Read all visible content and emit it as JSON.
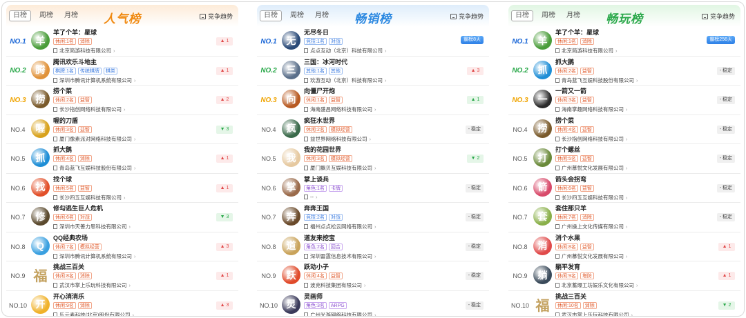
{
  "colors": {
    "pop_header": "#fdebd8",
    "sale_header": "#deedfb",
    "play_header": "#e1f6e3",
    "rank1": "#1a66d6",
    "rank2": "#2aa84a",
    "rank3": "#f0a400"
  },
  "panels": [
    {
      "id": "popular",
      "tabs": [
        "日榜",
        "周榜",
        "月榜"
      ],
      "title": "人气榜",
      "title_color": "#f08a12",
      "trend": "竞争趋势",
      "rows": [
        {
          "rank": "NO.1",
          "name": "羊了个羊：星球",
          "tags": [
            {
              "t": "休闲:1名",
              "c": "orange"
            },
            {
              "t": "消除",
              "c": "orange"
            }
          ],
          "company": "北京简游科技有限公司",
          "badge": "▲ 1",
          "btype": "up",
          "icon": "sheep-icon",
          "bg": "#4a9d3a"
        },
        {
          "rank": "NO.2",
          "name": "腾讯欢乐斗地主",
          "tags": [
            {
              "t": "棋牌:1名",
              "c": "blue"
            },
            {
              "t": "传统棋牌",
              "c": "blue"
            },
            {
              "t": "棋类",
              "c": "blue"
            }
          ],
          "company": "深圳市腾讯计算机系统有限公司",
          "badge": "▲ 1",
          "btype": "up",
          "icon": "farmer-icon",
          "bg": "#e0923a"
        },
        {
          "rank": "NO.3",
          "name": "捞个菜",
          "tags": [
            {
              "t": "休闲:2名",
              "c": "orange"
            },
            {
              "t": "益智",
              "c": "orange"
            }
          ],
          "company": "长沙指创网络科技有限公司",
          "badge": "▲ 2",
          "btype": "up",
          "icon": "vegetable-icon",
          "bg": "#7a5a2b"
        },
        {
          "rank": "NO.4",
          "name": "喔的刀盾",
          "tags": [
            {
              "t": "休闲:3名",
              "c": "orange"
            },
            {
              "t": "益智",
              "c": "orange"
            }
          ],
          "company": "厦门像素派对网络科技有限公司",
          "badge": "▼ 3",
          "btype": "down",
          "icon": "knife-icon",
          "bg": "#d8a21c"
        },
        {
          "rank": "NO.5",
          "name": "抓大鹅",
          "tags": [
            {
              "t": "休闲:4名",
              "c": "orange"
            },
            {
              "t": "消除",
              "c": "orange"
            }
          ],
          "company": "青岛蓝飞互娱科技股份有限公司",
          "badge": "▲ 1",
          "btype": "up",
          "icon": "goose-icon",
          "bg": "#1e8ed6"
        },
        {
          "rank": "NO.6",
          "name": "找个球",
          "tags": [
            {
              "t": "休闲:5名",
              "c": "orange"
            },
            {
              "t": "益智",
              "c": "orange"
            }
          ],
          "company": "长沙四五互娱科技有限公司",
          "badge": "▲ 1",
          "btype": "up",
          "icon": "ball-icon",
          "bg": "#e2502a"
        },
        {
          "rank": "NO.7",
          "name": "修勾逃生巨人危机",
          "tags": [
            {
              "t": "休闲:6名",
              "c": "orange"
            },
            {
              "t": "对战",
              "c": "orange"
            }
          ],
          "company": "深圳市天善力思科技有限公司",
          "badge": "▼ 3",
          "btype": "down",
          "icon": "dog-icon",
          "bg": "#5b4a2e"
        },
        {
          "rank": "NO.8",
          "name": "QQ经典农场",
          "tags": [
            {
              "t": "休闲:7名",
              "c": "orange"
            },
            {
              "t": "模拟经营",
              "c": "orange"
            }
          ],
          "company": "深圳市腾讯计算机系统有限公司",
          "badge": "▲ 3",
          "btype": "up",
          "icon": "farm-icon",
          "bg": "#3aa0e0"
        },
        {
          "rank": "NO.9",
          "name": "挑战三百关",
          "tags": [
            {
              "t": "休闲:8名",
              "c": "orange"
            },
            {
              "t": "消除",
              "c": "orange"
            }
          ],
          "company": "武汉市掌上乐玩科技有限公司",
          "badge": "▲ 1",
          "btype": "up",
          "icon": "fu-icon",
          "bg": "fu"
        },
        {
          "rank": "NO.10",
          "name": "开心消消乐",
          "tags": [
            {
              "t": "休闲:9名",
              "c": "orange"
            },
            {
              "t": "消除",
              "c": "orange"
            }
          ],
          "company": "乐元素科技(北京)股份有限公司",
          "badge": "▲ 3",
          "btype": "up",
          "icon": "chick-icon",
          "bg": "#f0b22a"
        }
      ]
    },
    {
      "id": "bestseller",
      "tabs": [
        "日榜",
        "周榜",
        "月榜"
      ],
      "title": "畅销榜",
      "title_color": "#2a87e0",
      "trend": "竞争趋势",
      "rows": [
        {
          "rank": "NO.1",
          "name": "无尽冬日",
          "tags": [
            {
              "t": "竞技:1名",
              "c": "blue"
            },
            {
              "t": "对战",
              "c": "blue"
            }
          ],
          "company": "点点互动（北京）科技有限公司",
          "badge": "霸榜8天",
          "btype": "pill",
          "icon": "winter-icon",
          "bg": "#2a4a78"
        },
        {
          "rank": "NO.2",
          "name": "三国：冰河时代",
          "tags": [
            {
              "t": "其他:1名",
              "c": "blue"
            },
            {
              "t": "其他",
              "c": "blue"
            }
          ],
          "company": "欢游互动（北京）科技有限公司",
          "badge": "▲ 3",
          "btype": "up",
          "icon": "warrior-icon",
          "bg": "#5a6f8a"
        },
        {
          "rank": "NO.3",
          "name": "向僵尸开炮",
          "tags": [
            {
              "t": "休闲:1名",
              "c": "orange"
            },
            {
              "t": "益智",
              "c": "orange"
            }
          ],
          "company": "海南盛昌网络科技有限公司",
          "badge": "▲ 1",
          "btype": "down",
          "icon": "zombie-icon",
          "bg": "#b85a22"
        },
        {
          "rank": "NO.4",
          "name": "疯狂水世界",
          "tags": [
            {
              "t": "休闲:2名",
              "c": "orange"
            },
            {
              "t": "模拟经营",
              "c": "orange"
            }
          ],
          "company": "益世界网络科技有限公司",
          "badge": "- 稳定",
          "btype": "flat",
          "icon": "water-icon",
          "bg": "#3a6a4a"
        },
        {
          "rank": "NO.5",
          "name": "我的花园世界",
          "tags": [
            {
              "t": "休闲:3名",
              "c": "orange"
            },
            {
              "t": "模拟经营",
              "c": "orange"
            }
          ],
          "company": "厦门飘贝互娱科技有限公司",
          "badge": "▼ 2",
          "btype": "down",
          "icon": "garden-icon",
          "bg": "#e6c9a0"
        },
        {
          "rank": "NO.6",
          "name": "掌上谈兵",
          "tags": [
            {
              "t": "角色:1名",
              "c": "purple"
            },
            {
              "t": "卡牌",
              "c": "purple"
            }
          ],
          "company": "--",
          "badge": "- 稳定",
          "btype": "flat",
          "icon": "soldier-icon",
          "bg": "#9a6a4a"
        },
        {
          "rank": "NO.7",
          "name": "奔奔王国",
          "tags": [
            {
              "t": "竞技:2名",
              "c": "blue"
            },
            {
              "t": "对战",
              "c": "blue"
            }
          ],
          "company": "福州点点松云网络有限公司",
          "badge": "- 稳定",
          "btype": "flat",
          "icon": "kingdom-icon",
          "bg": "#6a4a2a"
        },
        {
          "rank": "NO.8",
          "name": "道友来挖宝",
          "tags": [
            {
              "t": "角色:2名",
              "c": "purple"
            },
            {
              "t": "回合",
              "c": "purple"
            }
          ],
          "company": "深圳雷霆信息技术有限公司",
          "badge": "- 稳定",
          "btype": "flat",
          "icon": "treasure-icon",
          "bg": "#c9a35a"
        },
        {
          "rank": "NO.9",
          "name": "跃动小子",
          "tags": [
            {
              "t": "休闲:4名",
              "c": "orange"
            },
            {
              "t": "益智",
              "c": "orange"
            }
          ],
          "company": "波克科技集团有限公司",
          "badge": "- 稳定",
          "btype": "flat",
          "icon": "kid-icon",
          "bg": "#e04a2a"
        },
        {
          "rank": "NO.10",
          "name": "灵画师",
          "tags": [
            {
              "t": "角色:3名",
              "c": "purple"
            },
            {
              "t": "ARPG",
              "c": "purple"
            }
          ],
          "company": "广州光游网络科技有限公司",
          "badge": "- 稳定",
          "btype": "flat",
          "icon": "painter-icon",
          "bg": "#3a3a5a"
        }
      ]
    },
    {
      "id": "mostplayed",
      "tabs": [
        "日榜",
        "周榜",
        "月榜"
      ],
      "title": "畅玩榜",
      "title_color": "#2aa84a",
      "trend": "竞争趋势",
      "rows": [
        {
          "rank": "NO.1",
          "name": "羊了个羊：星球",
          "tags": [
            {
              "t": "休闲:1名",
              "c": "orange"
            },
            {
              "t": "消除",
              "c": "orange"
            }
          ],
          "company": "北京简游科技有限公司",
          "badge": "霸榜256天",
          "btype": "pill",
          "icon": "sheep-icon",
          "bg": "#4a9d3a"
        },
        {
          "rank": "NO.2",
          "name": "抓大鹅",
          "tags": [
            {
              "t": "休闲:2名",
              "c": "orange"
            },
            {
              "t": "益智",
              "c": "orange"
            }
          ],
          "company": "青岛蓝飞互娱科技股份有限公司",
          "badge": "- 稳定",
          "btype": "flat",
          "icon": "goose-icon",
          "bg": "#1e8ed6"
        },
        {
          "rank": "NO.3",
          "name": "一箭又一箭",
          "tags": [
            {
              "t": "休闲:3名",
              "c": "orange"
            },
            {
              "t": "益智",
              "c": "orange"
            }
          ],
          "company": "海南掌趣网络科技有限公司",
          "badge": "- 稳定",
          "btype": "flat",
          "icon": "arrow-icon",
          "bg": "#2a2a2a"
        },
        {
          "rank": "NO.4",
          "name": "捞个菜",
          "tags": [
            {
              "t": "休闲:4名",
              "c": "orange"
            },
            {
              "t": "益智",
              "c": "orange"
            }
          ],
          "company": "长沙指创网络科技有限公司",
          "badge": "- 稳定",
          "btype": "flat",
          "icon": "vegetable-icon",
          "bg": "#7a5a2b"
        },
        {
          "rank": "NO.5",
          "name": "打个螺丝",
          "tags": [
            {
              "t": "休闲:5名",
              "c": "orange"
            },
            {
              "t": "益智",
              "c": "orange"
            }
          ],
          "company": "广州慕悦文化发展有限公司",
          "badge": "- 稳定",
          "btype": "flat",
          "icon": "screw-icon",
          "bg": "#6a8a3a"
        },
        {
          "rank": "NO.6",
          "name": "箭头会拐弯",
          "tags": [
            {
              "t": "休闲:6名",
              "c": "orange"
            },
            {
              "t": "益智",
              "c": "orange"
            }
          ],
          "company": "长沙四五互娱科技有限公司",
          "badge": "- 稳定",
          "btype": "flat",
          "icon": "curve-arrow-icon",
          "bg": "#d84a6a"
        },
        {
          "rank": "NO.7",
          "name": "套住那只羊",
          "tags": [
            {
              "t": "休闲:7名",
              "c": "orange"
            },
            {
              "t": "消除",
              "c": "orange"
            }
          ],
          "company": "广州操上文化传媒有限公司",
          "badge": "- 稳定",
          "btype": "flat",
          "icon": "lasso-icon",
          "bg": "#8ab04a"
        },
        {
          "rank": "NO.8",
          "name": "消个水果",
          "tags": [
            {
              "t": "休闲:8名",
              "c": "orange"
            },
            {
              "t": "益智",
              "c": "orange"
            }
          ],
          "company": "广州慕悦文化发展有限公司",
          "badge": "▲ 1",
          "btype": "up",
          "icon": "fruit-icon",
          "bg": "#e04a4a"
        },
        {
          "rank": "NO.9",
          "name": "躺平发育",
          "tags": [
            {
              "t": "休闲:9名",
              "c": "orange"
            },
            {
              "t": "塔防",
              "c": "orange"
            }
          ],
          "company": "北京蓄爆工坊娱乐文化有限公司",
          "badge": "▲ 1",
          "btype": "up",
          "icon": "lying-icon",
          "bg": "#3a4a5a"
        },
        {
          "rank": "NO.10",
          "name": "挑战三百关",
          "tags": [
            {
              "t": "休闲:10名",
              "c": "orange"
            },
            {
              "t": "消除",
              "c": "orange"
            }
          ],
          "company": "武汉市掌上乐玩科技有限公司",
          "badge": "▼ 2",
          "btype": "down",
          "icon": "fu-icon",
          "bg": "fu"
        }
      ]
    }
  ]
}
